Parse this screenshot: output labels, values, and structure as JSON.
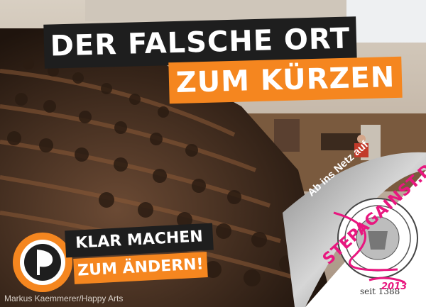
{
  "headline": {
    "line1": "DER FALSCHE ORT",
    "line2": "ZUM KÜRZEN"
  },
  "slogan": {
    "line1": "KLAR MACHEN",
    "line2": "ZUM ÄNDERN!"
  },
  "credit": "Markus Kaemmerer/Happy Arts",
  "peel": {
    "text": "Ab ins Netz auf",
    "url": "STEPAGAINST.DE"
  },
  "seal": {
    "founded": "seit 1388",
    "scribble": "2013"
  },
  "colors": {
    "orange": "#f5861f",
    "black": "#1e1e1e",
    "magenta": "#e8177f"
  },
  "icons": {
    "logo": "pirate-party-sail-icon",
    "seal": "university-seal-icon"
  }
}
